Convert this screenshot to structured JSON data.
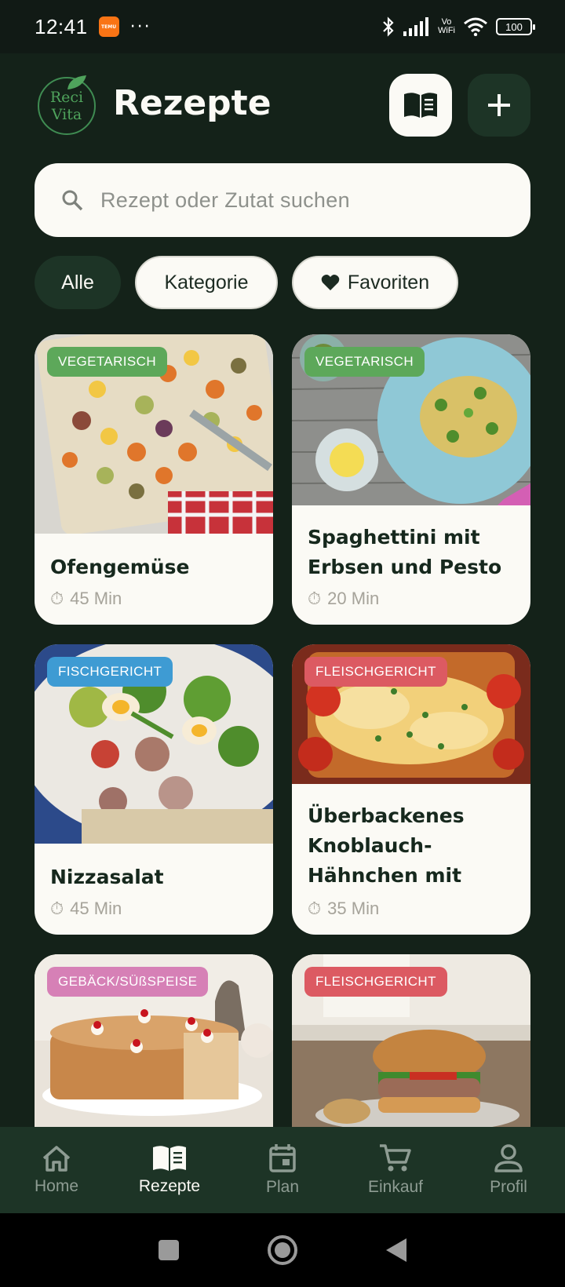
{
  "status_bar": {
    "time": "12:41",
    "app_icon": "temu-icon",
    "more": "···",
    "network": "Vo WiFi",
    "battery": "100"
  },
  "header": {
    "logo_line1": "Reci",
    "logo_line2": "Vita",
    "title": "Rezepte",
    "book_button_icon": "book-icon",
    "add_button_icon": "plus-icon"
  },
  "search": {
    "placeholder": "Rezept oder Zutat suchen",
    "icon": "search-icon"
  },
  "filters": {
    "all": "Alle",
    "category": "Kategorie",
    "favorites": "Favoriten"
  },
  "recipes": [
    {
      "category": "VEGETARISCH",
      "category_color": "#5DA85A",
      "title": "Ofengemüse",
      "time": "45 Min"
    },
    {
      "category": "VEGETARISCH",
      "category_color": "#5DA85A",
      "title": "Spaghettini mit Erbsen und Pesto",
      "time": "20 Min"
    },
    {
      "category": "FISCHGERICHT",
      "category_color": "#3E9BD3",
      "title": "Nizzasalat",
      "time": "45 Min"
    },
    {
      "category": "FLEISCHGERICHT",
      "category_color": "#DC5A62",
      "title": "Überbackenes Knoblauch-Hähnchen mit Mo…",
      "time": "35 Min"
    },
    {
      "category": "GEBÄCK/SÜßSPEISE",
      "category_color": "#D680B6",
      "title": "",
      "time": ""
    },
    {
      "category": "FLEISCHGERICHT",
      "category_color": "#DC5A62",
      "title": "",
      "time": ""
    }
  ],
  "bottom_nav": {
    "home": "Home",
    "recipes": "Rezepte",
    "plan": "Plan",
    "shopping": "Einkauf",
    "profile": "Profil"
  },
  "colors": {
    "background": "#142219",
    "surface_dark": "#1D3426",
    "card": "#FBFAF5",
    "accent_green": "#4FA35C"
  }
}
